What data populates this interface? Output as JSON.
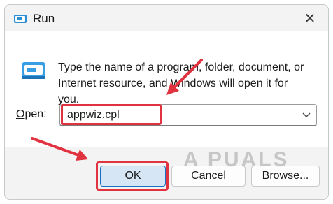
{
  "window": {
    "title": "Run",
    "close_label": "✕"
  },
  "body": {
    "description": "Type the name of a program, folder, document, or Internet resource, and Windows will open it for you.",
    "open_label_first": "O",
    "open_label_rest": "pen:",
    "input_value": "appwiz.cpl"
  },
  "buttons": {
    "ok": "OK",
    "cancel": "Cancel",
    "browse": "Browse..."
  },
  "watermark": "A PUALS",
  "colors": {
    "annotation_red": "#e0333f",
    "ok_border": "#1a6fc4"
  }
}
